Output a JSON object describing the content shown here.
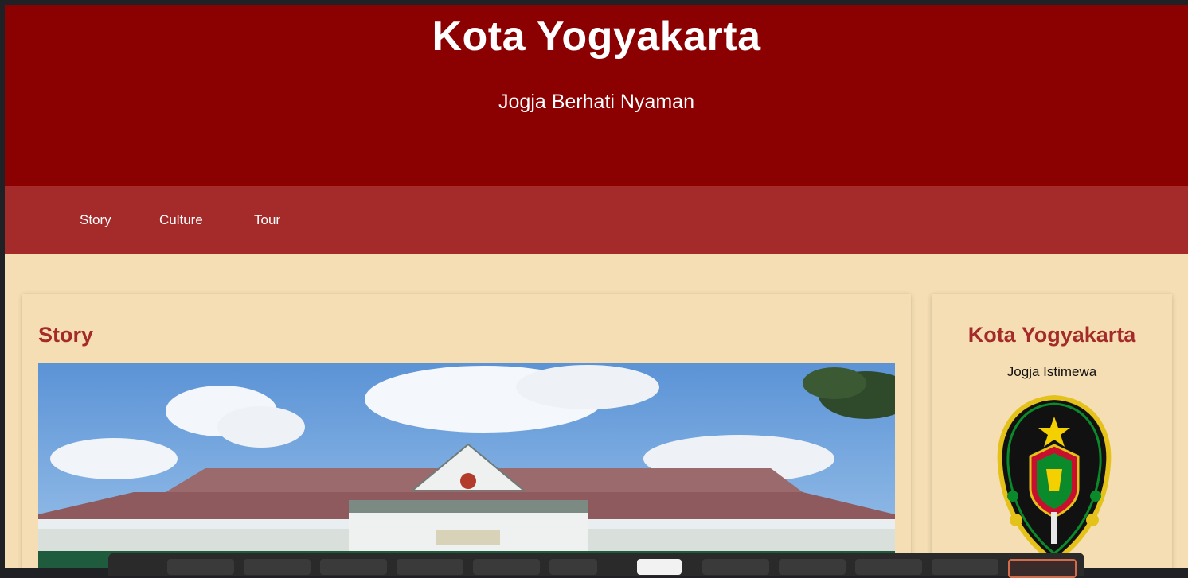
{
  "header": {
    "title": "Kota Yogyakarta",
    "subtitle": "Jogja Berhati Nyaman"
  },
  "nav": {
    "items": [
      {
        "label": "Story"
      },
      {
        "label": "Culture"
      },
      {
        "label": "Tour"
      }
    ]
  },
  "main": {
    "heading": "Story"
  },
  "sidebar": {
    "title": "Kota Yogyakarta",
    "tagline": "Jogja Istimewa"
  },
  "colors": {
    "header_bg": "#8b0000",
    "nav_bg": "#a52a2a",
    "page_bg": "#f5deb3",
    "heading": "#a52a2a"
  }
}
